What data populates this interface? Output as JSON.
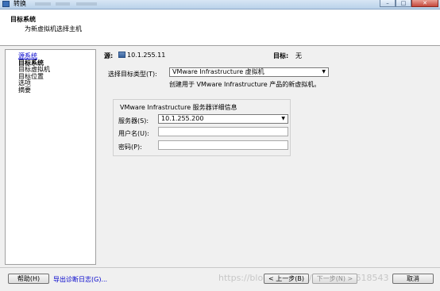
{
  "window": {
    "title": "转换",
    "controls": [
      "minimize",
      "maximize",
      "close"
    ]
  },
  "header": {
    "title": "目标系统",
    "subtitle": "为新虚拟机选择主机"
  },
  "steps": [
    {
      "label": "源系统",
      "state": "link"
    },
    {
      "label": "目标系统",
      "state": "current"
    },
    {
      "label": "目标虚拟机",
      "state": "normal"
    },
    {
      "label": "目标位置",
      "state": "normal"
    },
    {
      "label": "选项",
      "state": "normal"
    },
    {
      "label": "摘要",
      "state": "normal"
    }
  ],
  "main": {
    "source_label": "源:",
    "source_value": "10.1.255.11",
    "target_label": "目标:",
    "target_value": "无",
    "dest_type_label": "选择目标类型(T):",
    "dest_type_value": "VMware Infrastructure 虚拟机",
    "dest_type_desc": "创建用于 VMware Infrastructure 产品的新虚拟机。",
    "group_title": "VMware Infrastructure 服务器详细信息",
    "server_label": "服务器(S):",
    "server_value": "10.1.255.200",
    "username_label": "用户名(U):",
    "username_value": "",
    "password_label": "密码(P):",
    "password_value": ""
  },
  "footer": {
    "help": "帮助(H)",
    "export_logs": "导出诊断日志(G)...",
    "back": "< 上一步(B)",
    "next": "下一步(N) >",
    "cancel": "取消"
  },
  "watermark": "https://blog.csdn.net/weixin_41618543",
  "colors": {
    "link": "#0000cc",
    "header_bg": "#ffffff",
    "window_bg": "#f0f0f0"
  }
}
